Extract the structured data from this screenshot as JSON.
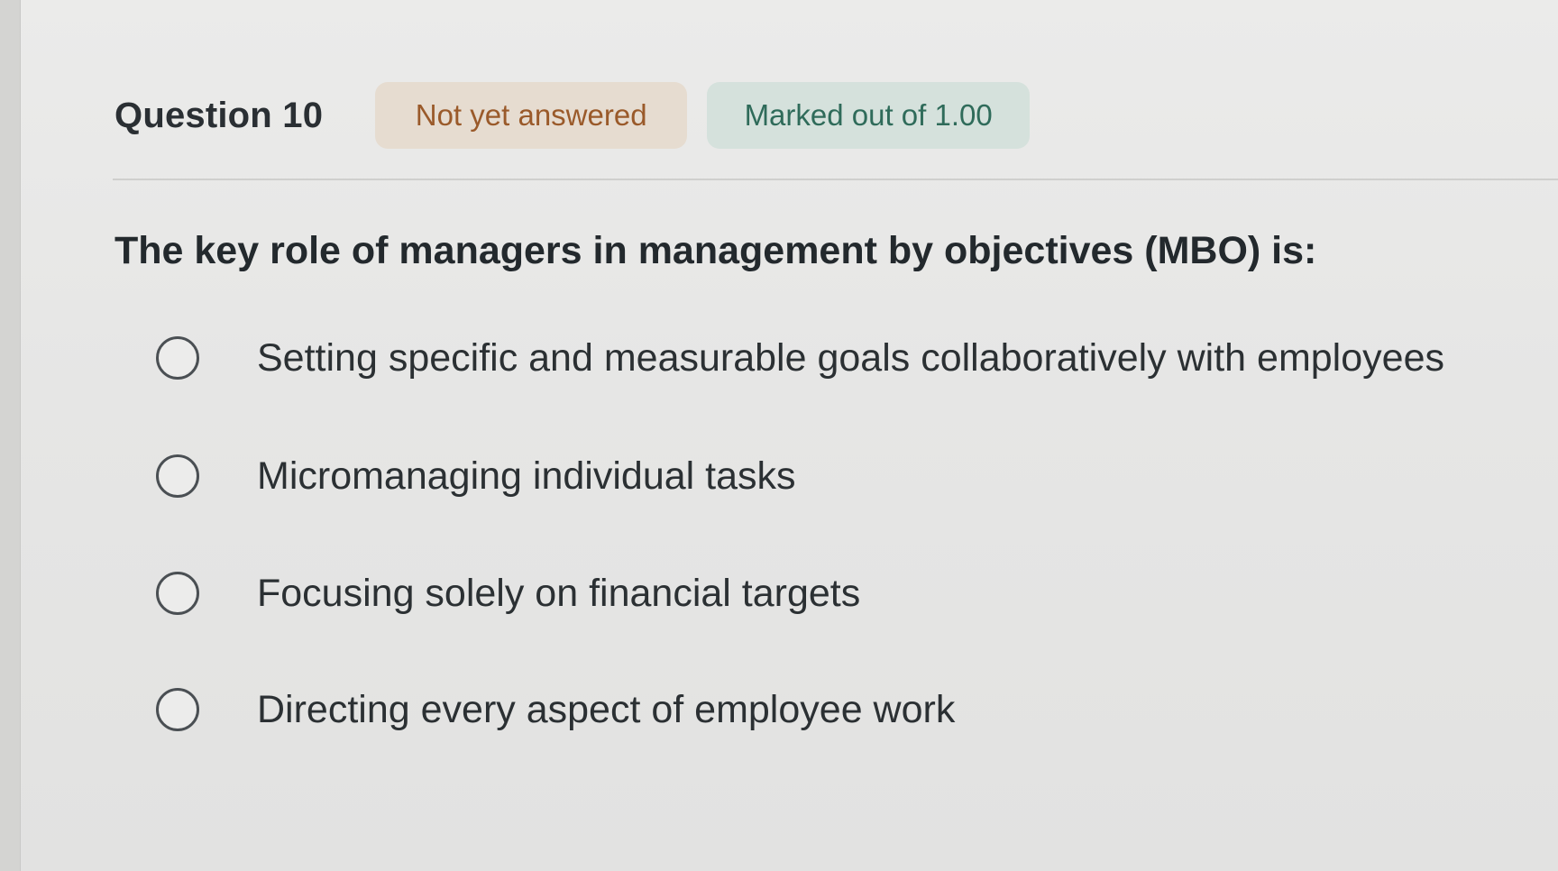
{
  "question": {
    "number_label": "Question 10",
    "status_badge": "Not yet answered",
    "marks_badge": "Marked out of 1.00",
    "text": "The key role of managers in management by objectives (MBO) is:"
  },
  "options": [
    {
      "label": "Setting specific and measurable goals collaboratively with employees",
      "selected": false
    },
    {
      "label": "Micromanaging individual tasks",
      "selected": false
    },
    {
      "label": "Focusing solely on financial targets",
      "selected": false
    },
    {
      "label": "Directing every aspect of employee work",
      "selected": false
    }
  ],
  "colors": {
    "status_badge_bg": "#e6dcd0",
    "status_badge_text": "#9a5a2a",
    "marks_badge_bg": "#d5e1dc",
    "marks_badge_text": "#2f6b5a"
  }
}
